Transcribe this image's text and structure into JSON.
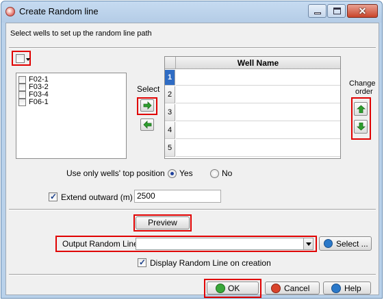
{
  "window": {
    "title": "Create Random line"
  },
  "instruction": "Select wells to set up the random line path",
  "wells": [
    "F02-1",
    "F03-2",
    "F03-4",
    "F06-1"
  ],
  "select_label": "Select",
  "table": {
    "header": "Well Name",
    "rows": [
      {
        "num": "1",
        "value": ""
      },
      {
        "num": "2",
        "value": ""
      },
      {
        "num": "3",
        "value": ""
      },
      {
        "num": "4",
        "value": ""
      },
      {
        "num": "5",
        "value": ""
      }
    ]
  },
  "change_order": {
    "line1": "Change",
    "line2": "order"
  },
  "top_position": {
    "label": "Use only wells' top position",
    "yes": "Yes",
    "no": "No",
    "selected": "Yes"
  },
  "extend": {
    "label": "Extend outward (m)",
    "value": "2500",
    "checked": true
  },
  "preview_label": "Preview",
  "output": {
    "label": "Output Random Line",
    "value": "",
    "select_label": "Select ..."
  },
  "display_on_creation": {
    "label": "Display Random Line on creation",
    "checked": true
  },
  "buttons": {
    "ok": "OK",
    "cancel": "Cancel",
    "help": "Help"
  },
  "colors": {
    "highlight": "#e00000",
    "selected_row": "#2f6cc4",
    "arrow_green": "#2e9e2e"
  }
}
